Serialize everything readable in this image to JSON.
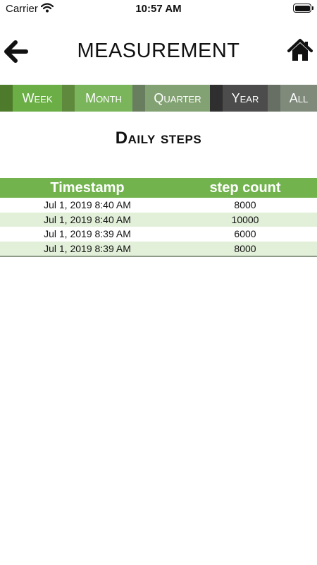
{
  "status_bar": {
    "carrier": "Carrier",
    "time": "10:57 AM"
  },
  "header": {
    "title": "MEASUREMENT",
    "back_icon": "back-arrow-icon",
    "home_icon": "home-icon"
  },
  "tabs": [
    {
      "label": "Week",
      "color": "#6aae45"
    },
    {
      "label": "Month",
      "color": "#7ab55c"
    },
    {
      "label": "Quarter",
      "color": "#83a273"
    },
    {
      "label": "Year",
      "color": "#4c4c4c"
    },
    {
      "label": "All",
      "color": "#7f8a7b"
    }
  ],
  "section_title": "Daily steps",
  "table": {
    "headers": [
      "Timestamp",
      "step count"
    ],
    "rows": [
      [
        "Jul 1, 2019 8:40 AM",
        "8000"
      ],
      [
        "Jul 1, 2019 8:40 AM",
        "10000"
      ],
      [
        "Jul 1, 2019 8:39 AM",
        "6000"
      ],
      [
        "Jul 1, 2019 8:39 AM",
        "8000"
      ]
    ]
  },
  "colors": {
    "tab_bar": "#59812f",
    "table_header": "#72b34e",
    "row_alt": "#e2efd9"
  }
}
